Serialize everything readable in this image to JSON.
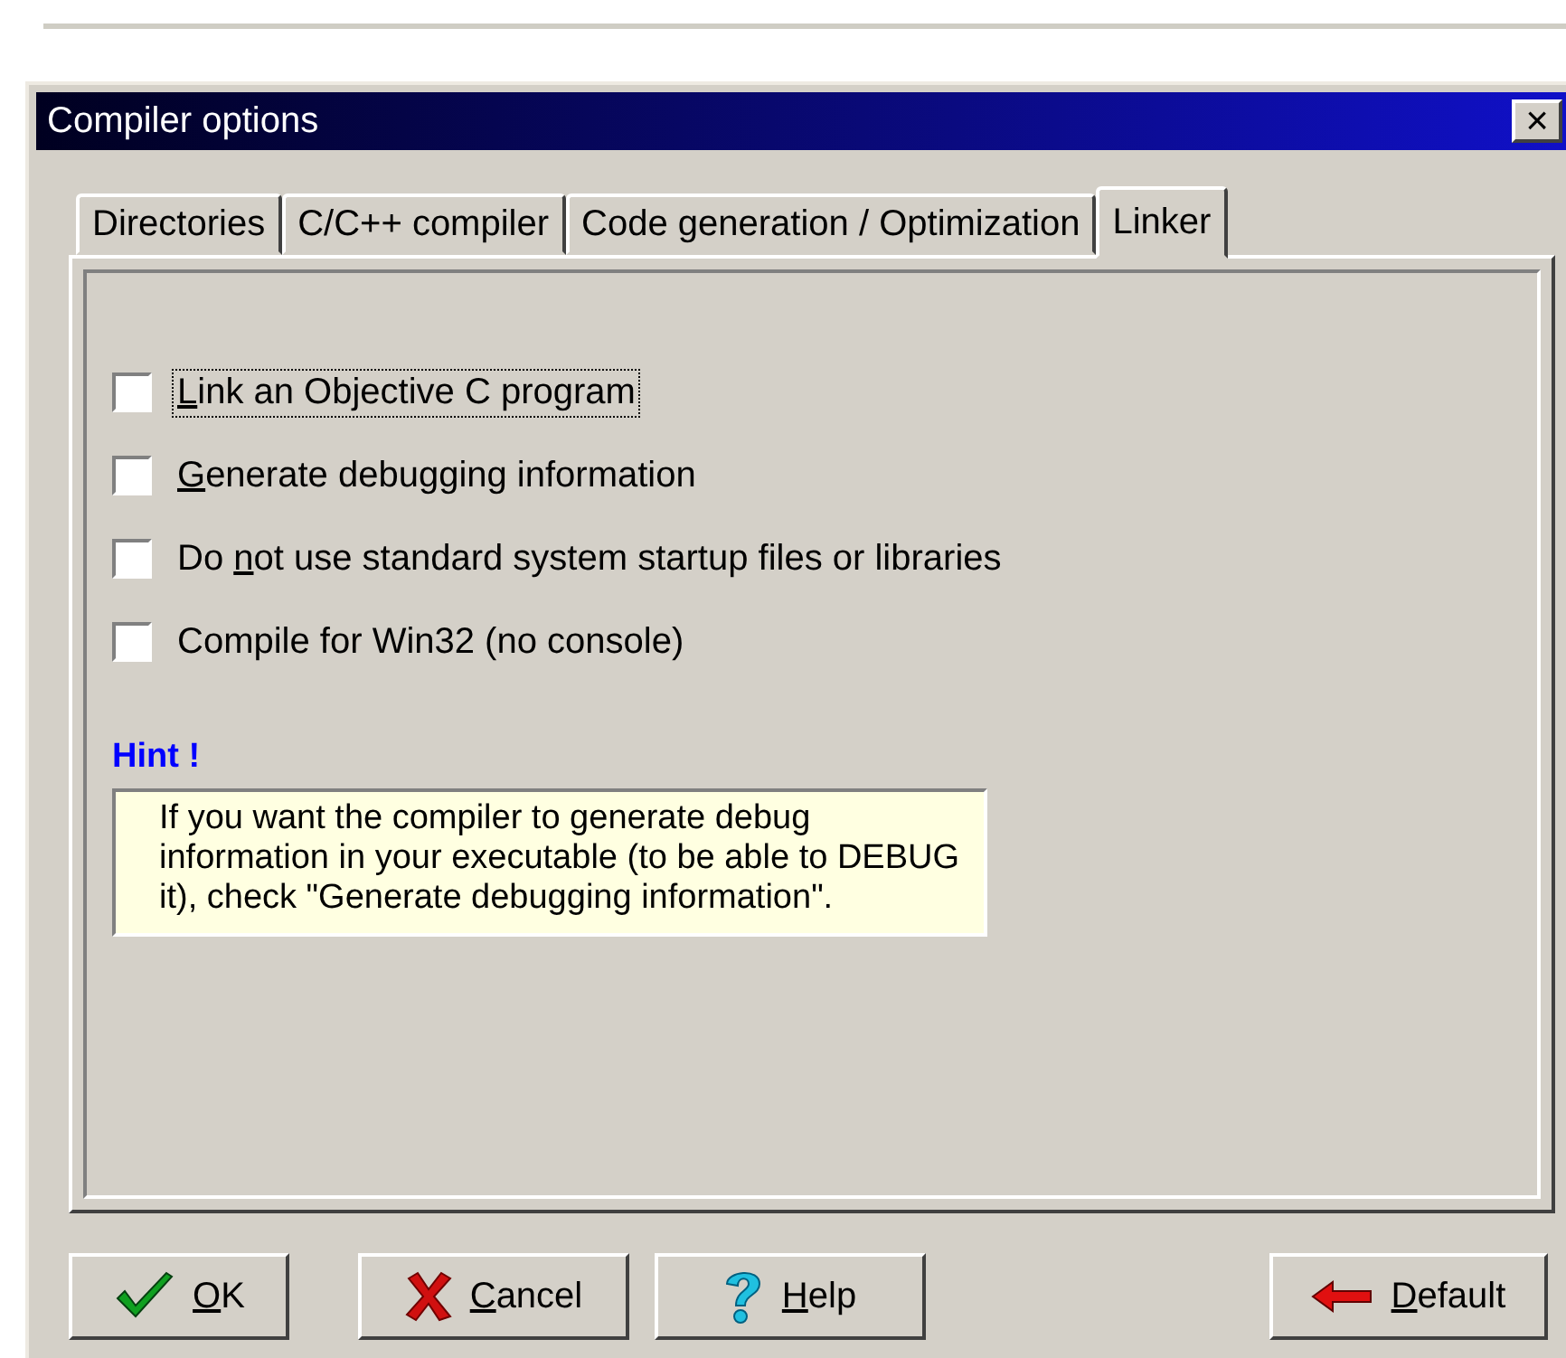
{
  "window": {
    "title": "Compiler options",
    "close": "×"
  },
  "tabs": [
    {
      "label": "Directories",
      "selected": false
    },
    {
      "label": "C/C++ compiler",
      "selected": false
    },
    {
      "label": "Code generation / Optimization",
      "selected": false
    },
    {
      "label": "Linker",
      "selected": true
    }
  ],
  "options": [
    {
      "key": "L",
      "post": "ink an Objective C program",
      "checked": false,
      "focused": true
    },
    {
      "key": "G",
      "post": "enerate debugging information",
      "checked": false,
      "focused": false
    },
    {
      "pre": "Do ",
      "key": "n",
      "post": "ot use standard system startup files or libraries",
      "checked": false,
      "focused": false
    },
    {
      "pre": "Compile for Win32 (no console)",
      "checked": false,
      "focused": false
    }
  ],
  "hint": {
    "title": "Hint !",
    "text": "If you want the compiler to generate debug information in your executable (to be able to DEBUG it), check \"Generate debugging information\"."
  },
  "buttons": [
    {
      "kind": "ok",
      "key": "O",
      "post": "K"
    },
    {
      "kind": "cancel",
      "key": "C",
      "post": "ancel"
    },
    {
      "kind": "help",
      "key": "H",
      "post": "elp"
    },
    {
      "kind": "default",
      "key": "D",
      "post": "efault"
    }
  ]
}
